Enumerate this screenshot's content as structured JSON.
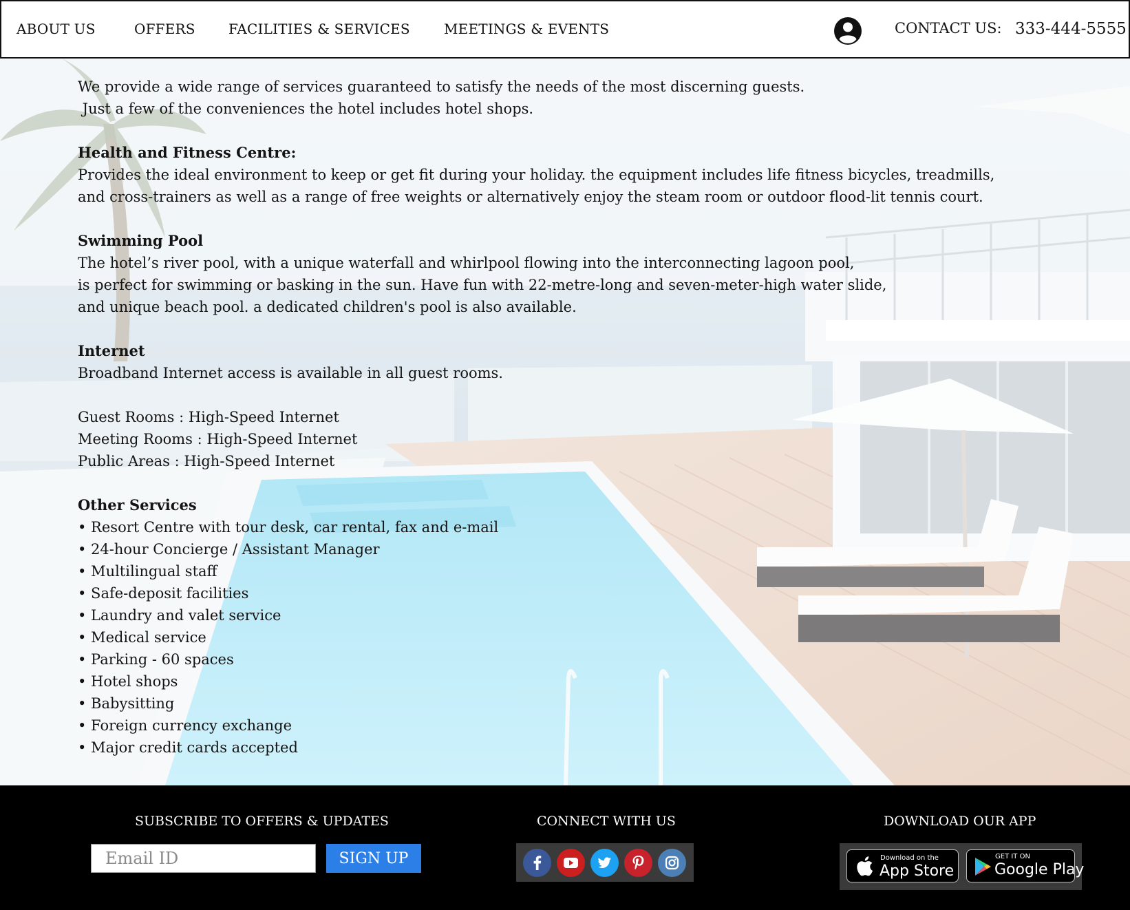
{
  "nav": {
    "items": [
      "ABOUT US",
      "OFFERS",
      "FACILITIES & SERVICES",
      "MEETINGS & EVENTS"
    ],
    "user_icon": "user-circle-icon",
    "contact_label": "CONTACT US:",
    "contact_phone": "333-444-5555"
  },
  "content": {
    "intro": [
      "We provide a wide range of services guaranteed to satisfy the needs of the most discerning guests.",
      " Just a few of the conveniences the hotel includes hotel shops."
    ],
    "health": {
      "heading": "Health and Fitness Centre:",
      "lines": [
        "Provides the ideal environment to keep or get fit during your holiday. the equipment includes life fitness bicycles, treadmills,",
        "and cross-trainers as well as a range of free weights or alternatively enjoy the steam room or outdoor flood-lit tennis court."
      ]
    },
    "pool": {
      "heading": "Swimming Pool",
      "lines": [
        "The hotel’s river pool, with a unique waterfall and whirlpool flowing into the interconnecting lagoon pool,",
        "is perfect for swimming or basking in the sun. Have fun with 22-metre-long and seven-meter-high water slide,",
        "and unique beach pool. a dedicated children's pool is also available."
      ]
    },
    "internet": {
      "heading": "Internet",
      "line": "Broadband Internet access is available in all guest rooms.",
      "areas": [
        "Guest Rooms : High-Speed Internet",
        "Meeting Rooms : High-Speed Internet",
        "Public Areas : High-Speed Internet"
      ]
    },
    "other": {
      "heading": "Other Services",
      "items": [
        "• Resort Centre with tour desk, car rental, fax and e-mail",
        "• 24-hour Concierge / Assistant Manager",
        "• Multilingual staff",
        "• Safe-deposit facilities",
        "• Laundry and valet service",
        "• Medical service",
        "• Parking - 60 spaces",
        "• Hotel shops",
        "• Babysitting",
        "• Foreign currency exchange",
        "• Major credit cards accepted"
      ]
    }
  },
  "footer": {
    "subscribe_title": "SUBSCRIBE TO OFFERS & UPDATES",
    "email_placeholder": "Email ID",
    "signup_label": "SIGN UP",
    "connect_title": "CONNECT WITH US",
    "social": [
      {
        "name": "facebook-icon",
        "color": "#3b5998"
      },
      {
        "name": "youtube-icon",
        "color": "#cc1f1f"
      },
      {
        "name": "twitter-icon",
        "color": "#1da1f2"
      },
      {
        "name": "pinterest-icon",
        "color": "#c8232c"
      },
      {
        "name": "instagram-icon",
        "color": "#4b7fb5"
      }
    ],
    "app_title": "DOWNLOAD OUR APP",
    "app_store": {
      "small": "Download on the",
      "big": "App Store",
      "icon": "apple-icon"
    },
    "google_play": {
      "small": "GET IT ON",
      "big": "Google Play",
      "icon": "google-play-icon"
    }
  }
}
